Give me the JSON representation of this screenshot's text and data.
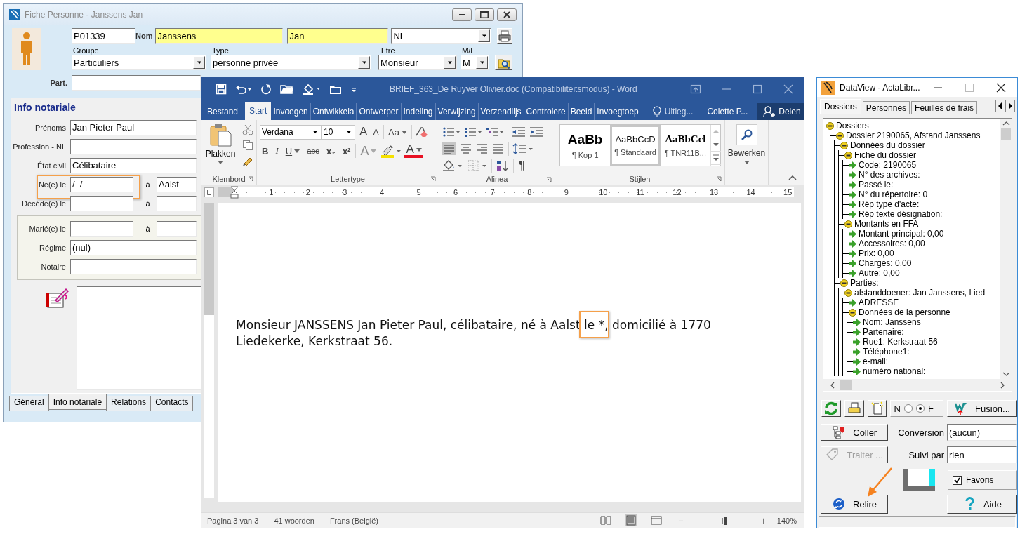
{
  "fiche": {
    "title": "Fiche Personne - Janssens Jan",
    "code": "P01339",
    "nom_label": "Nom",
    "nom": "Janssens",
    "prenom": "Jan",
    "langue": "NL",
    "groupe_label": "Groupe",
    "groupe": "Particuliers",
    "type_label": "Type",
    "type": "personne privée",
    "titre_label": "Titre",
    "titre": "Monsieur",
    "mf_label": "M/F",
    "mf": "M",
    "part_label": "Part.",
    "section_title": "Info notariale",
    "fields": [
      {
        "label": "Prénoms",
        "value": "Jan Pieter Paul",
        "kind": "text",
        "highlighted": false
      },
      {
        "label": "Profession - NL",
        "kind": "text",
        "highlighted": false
      },
      {
        "label": "État civil",
        "value": "Célibataire",
        "kind": "text",
        "highlighted": false
      },
      {
        "label": "Né(e) le",
        "value": "/  /",
        "kind": "place",
        "place_label": "à",
        "place": "Aalst",
        "highlighted": true
      },
      {
        "label": "Décédé(e) le",
        "kind": "place",
        "place_label": "à",
        "highlighted": false
      }
    ],
    "marriage_fields": [
      {
        "label": "Marié(e) le",
        "kind": "place",
        "place_label": "à",
        "highlighted": false
      },
      {
        "label": "Régime",
        "value": "(nul)",
        "kind": "text",
        "highlighted": false
      },
      {
        "label": "Notaire",
        "kind": "text",
        "highlighted": false
      }
    ],
    "tabs": [
      {
        "label": "Général",
        "selected": false
      },
      {
        "label": "Info notariale",
        "selected": true
      },
      {
        "label": "Relations",
        "selected": false
      },
      {
        "label": "Contacts",
        "selected": false
      }
    ]
  },
  "word": {
    "title": "BRIEF_363_De Ruyver Olivier.doc (Compatibiliteitsmodus) - Word",
    "tabs": [
      {
        "label": "Bestand",
        "selected": false
      },
      {
        "label": "Start",
        "selected": true
      },
      {
        "label": "Invoegen",
        "selected": false
      },
      {
        "label": "Ontwikkela",
        "selected": false
      },
      {
        "label": "Ontwerper",
        "selected": false
      },
      {
        "label": "Indeling",
        "selected": false
      },
      {
        "label": "Verwijzing",
        "selected": false
      },
      {
        "label": "Verzendlijs",
        "selected": false
      },
      {
        "label": "Controlere",
        "selected": false
      },
      {
        "label": "Beeld",
        "selected": false
      },
      {
        "label": "Invoegtoep",
        "selected": false
      }
    ],
    "tell_me": "Uitleg...",
    "user": "Colette P...",
    "share": "Delen",
    "paste": "Plakken",
    "clipboard_group": "Klembord",
    "font_name": "Verdana",
    "font_size": "10",
    "grow": "A",
    "shrink": "A",
    "change_case": "Aa",
    "format": [
      "B",
      "I",
      "U",
      "abc",
      "x₂",
      "x²"
    ],
    "text_effects": "A",
    "font_color": "A",
    "font_group": "Lettertype",
    "show_marks": "¶",
    "paragraph_group": "Alinea",
    "styles": [
      {
        "sample": "AaBb",
        "name": "¶ Kop 1",
        "kind": "heading",
        "selected": false
      },
      {
        "sample": "AaBbCcD",
        "name": "¶ Standaard",
        "kind": "normal",
        "selected": true
      },
      {
        "sample": "AaBbCcl",
        "name": "¶ TNR11B...",
        "kind": "serif",
        "selected": false
      }
    ],
    "styles_group": "Stijlen",
    "editing": "Bewerken",
    "ruler": [
      "1",
      "2",
      "3",
      "4",
      "5",
      "6",
      "7",
      "8",
      "9",
      "10",
      "11",
      "12",
      "13",
      "14",
      "15"
    ],
    "document": {
      "before": "Monsieur JANSSENS Jan Pieter Paul, célibataire, né à Aalst ",
      "highlight": "le *",
      "after": ", domicilié à 1770 Liedekerke, Kerkstraat 56."
    },
    "status": {
      "page": "Pagina 3 van 3",
      "words": "41 woorden",
      "language": "Frans (België)",
      "zoom_out": "−",
      "zoom_in": "+",
      "zoom": "140%"
    },
    "views": [
      {
        "kind": "read",
        "selected": false
      },
      {
        "kind": "print",
        "selected": true
      },
      {
        "kind": "web",
        "selected": false
      }
    ],
    "zoom_slider": {
      "level": 0.55
    }
  },
  "dataview": {
    "title": "DataView - ActaLibr...",
    "tabs": [
      {
        "label": "Dossiers",
        "selected": true
      },
      {
        "label": "Personnes",
        "selected": false
      },
      {
        "label": "Feuilles de frais",
        "selected": false
      }
    ],
    "tree": [
      {
        "label": "Dossiers",
        "kind": "group",
        "children": [
          {
            "label": "Dossier 2190065, Afstand Janssens",
            "kind": "group",
            "children": [
              {
                "label": "Données du dossier",
                "kind": "group",
                "children": [
                  {
                    "label": "Fiche du dossier",
                    "kind": "group",
                    "children": [
                      {
                        "label": "Code: 2190065",
                        "kind": "field"
                      },
                      {
                        "label": "N° des archives:",
                        "kind": "field"
                      },
                      {
                        "label": "Passé le:",
                        "kind": "field"
                      },
                      {
                        "label": "N° du répertoire: 0",
                        "kind": "field"
                      },
                      {
                        "label": "Rép type d'acte:",
                        "kind": "field"
                      },
                      {
                        "label": "Rép texte désignation:",
                        "kind": "field"
                      }
                    ]
                  },
                  {
                    "label": "Montants en FFA",
                    "kind": "group",
                    "children": [
                      {
                        "label": "Montant principal: 0,00",
                        "kind": "field"
                      },
                      {
                        "label": "Accessoires: 0,00",
                        "kind": "field"
                      },
                      {
                        "label": "Prix: 0,00",
                        "kind": "field"
                      },
                      {
                        "label": "Charges: 0,00",
                        "kind": "field"
                      },
                      {
                        "label": "Autre: 0,00",
                        "kind": "field"
                      }
                    ]
                  }
                ]
              },
              {
                "label": "Parties:",
                "kind": "group",
                "children": [
                  {
                    "label": "afstanddoener: Jan Janssens, Lied",
                    "kind": "group",
                    "children": [
                      {
                        "label": "ADRESSE",
                        "kind": "field"
                      },
                      {
                        "label": "Données de la personne",
                        "kind": "group",
                        "children": [
                          {
                            "label": "Nom: Janssens",
                            "kind": "field"
                          },
                          {
                            "label": "Partenaire:",
                            "kind": "field"
                          },
                          {
                            "label": "Rue1: Kerkstraat 56",
                            "kind": "field"
                          },
                          {
                            "label": "Téléphone1:",
                            "kind": "field"
                          },
                          {
                            "label": "e-mail:",
                            "kind": "field"
                          },
                          {
                            "label": "numéro national:",
                            "kind": "field"
                          }
                        ]
                      }
                    ]
                  }
                ]
              }
            ]
          }
        ]
      }
    ],
    "modes": [
      {
        "label": "N",
        "selected": false
      },
      {
        "label": "F",
        "selected": true
      }
    ],
    "fusion": {
      "label": "Fusion...",
      "disabled": false
    },
    "coller": {
      "label": "Coller",
      "disabled": false
    },
    "traiter": {
      "label": "Traiter ...",
      "disabled": true
    },
    "conversion_label": "Conversion",
    "conversion": "(aucun)",
    "suivi_label": "Suivi par",
    "suivi": "rien",
    "favoris": {
      "label": "Favoris",
      "checked": true
    },
    "relire": {
      "label": "Relire",
      "disabled": false
    },
    "aide": {
      "label": "Aide",
      "disabled": false
    }
  }
}
